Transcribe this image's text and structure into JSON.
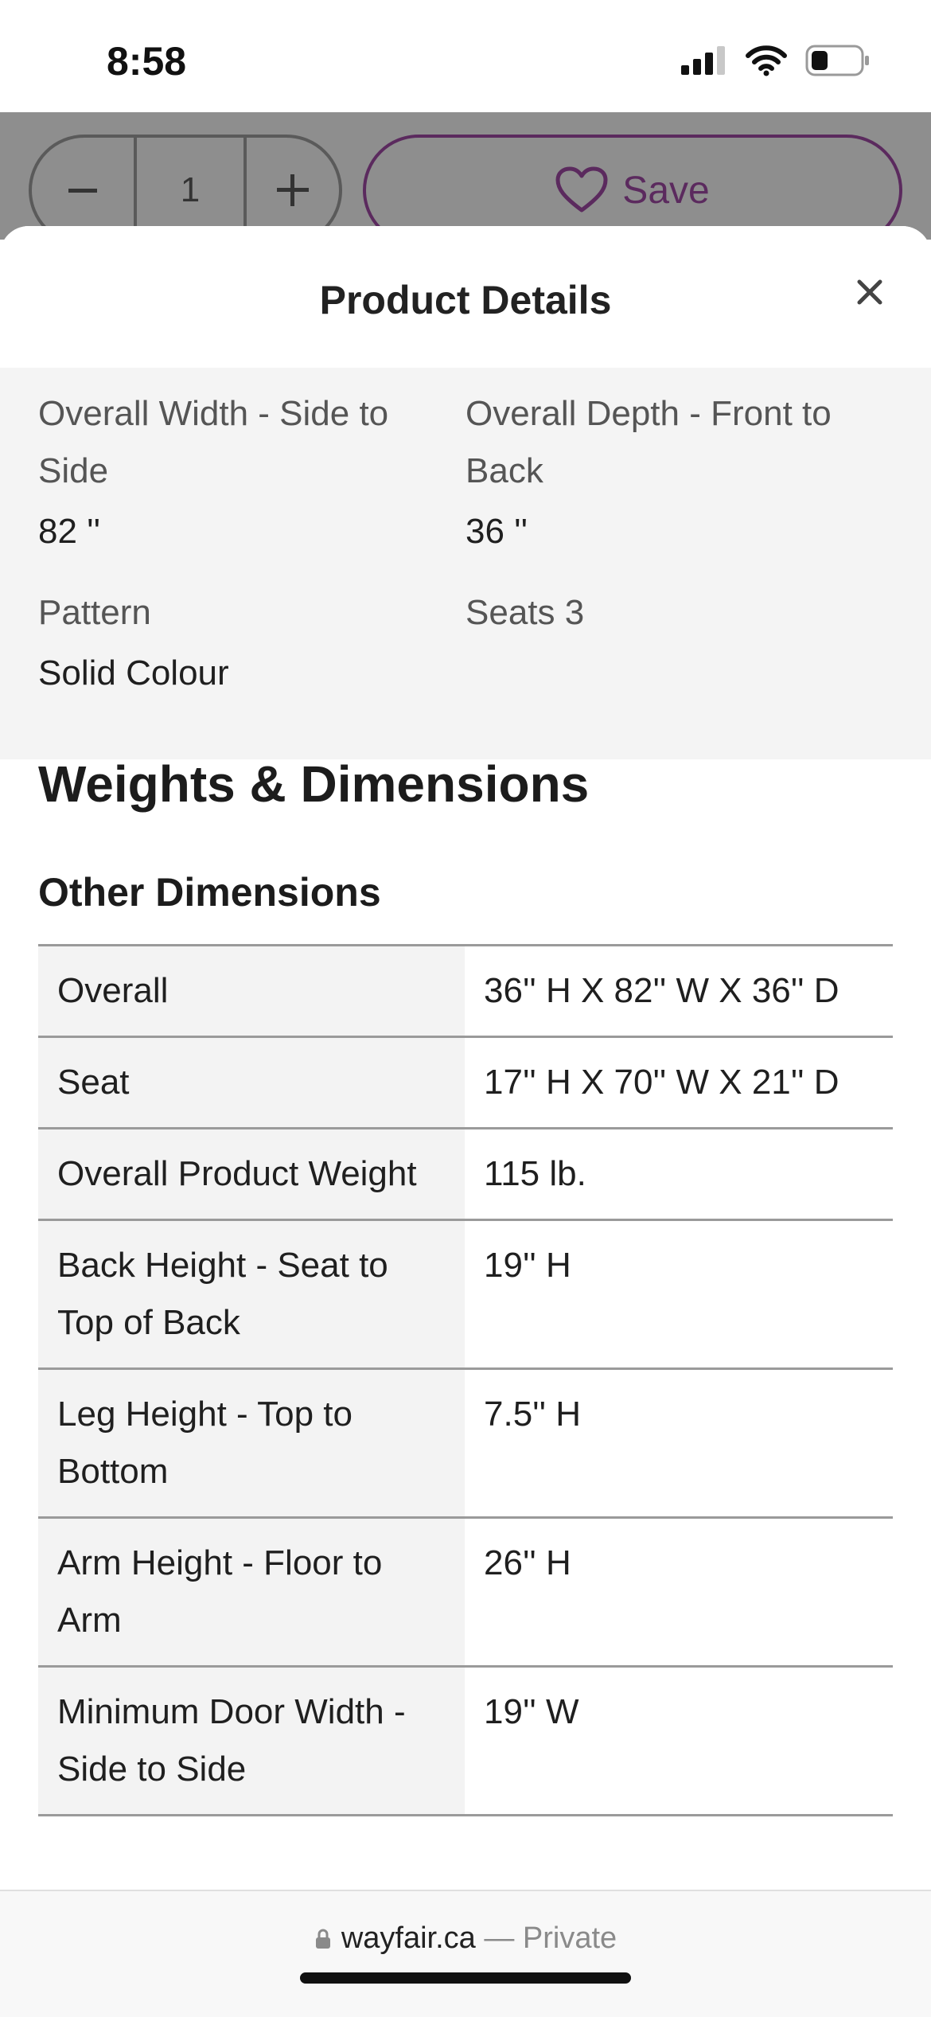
{
  "status_bar": {
    "time": "8:58"
  },
  "behind": {
    "quantity": "1",
    "save_label": "Save"
  },
  "sheet": {
    "title": "Product Details",
    "specs": [
      {
        "label": "Overall Width - Side to Side",
        "value": "82 ''"
      },
      {
        "label": "Overall Depth - Front to Back",
        "value": "36 ''"
      },
      {
        "label": "Pattern",
        "value": "Solid Colour"
      },
      {
        "label": "Seats 3",
        "value": ""
      }
    ],
    "section_title": "Weights & Dimensions",
    "subsection_title": "Other Dimensions",
    "dimensions": [
      {
        "name": "Overall",
        "value": "36'' H X 82'' W X 36'' D"
      },
      {
        "name": "Seat",
        "value": "17'' H X 70'' W X 21'' D"
      },
      {
        "name": "Overall Product Weight",
        "value": "115 lb."
      },
      {
        "name": "Back Height - Seat to Top of Back",
        "value": "19'' H"
      },
      {
        "name": "Leg Height - Top to Bottom",
        "value": "7.5'' H"
      },
      {
        "name": "Arm Height - Floor to Arm",
        "value": "26'' H"
      },
      {
        "name": "Minimum Door Width - Side to Side",
        "value": "19'' W"
      }
    ]
  },
  "browser": {
    "domain": "wayfair.ca",
    "private_label": "— Private"
  },
  "colors": {
    "brand_purple": "#5b2a5e",
    "spec_bg": "#f4f4f4"
  }
}
